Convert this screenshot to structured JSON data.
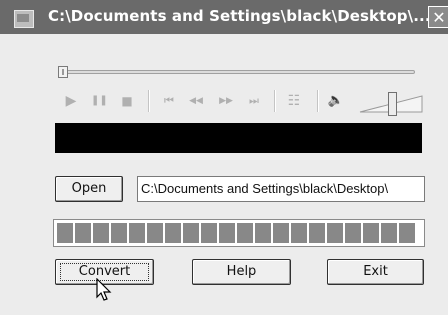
{
  "window": {
    "title": "C:\\Documents and Settings\\black\\Desktop\\...",
    "close_glyph": "✕"
  },
  "player": {
    "play": "▶",
    "pause": "❚❚",
    "stop": "■",
    "first": "⏮",
    "rewind": "◀◀",
    "forward": "▶▶",
    "last": "⏭",
    "playlist": "☷",
    "volume_icon": "🔈",
    "seek_position": 0.0,
    "volume_level": 0.45
  },
  "file": {
    "open_label": "Open",
    "path": "C:\\Documents and Settings\\black\\Desktop\\"
  },
  "progress": {
    "segments_filled": 20,
    "segments_total": 20
  },
  "actions": {
    "convert_label": "Convert",
    "help_label": "Help",
    "exit_label": "Exit"
  },
  "colors": {
    "titlebar": "#6a6a6a",
    "display": "#000000",
    "progress_fill": "#888888"
  }
}
